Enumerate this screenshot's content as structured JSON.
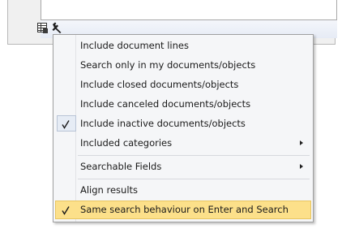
{
  "toolbar": {
    "icons": [
      "grid-icon",
      "wrench-icon"
    ]
  },
  "menu": {
    "items": [
      {
        "label": "Include document lines",
        "checked": false,
        "submenu": false
      },
      {
        "label": "Search only in my documents/objects",
        "checked": false,
        "submenu": false
      },
      {
        "label": "Include closed documents/objects",
        "checked": false,
        "submenu": false
      },
      {
        "label": "Include canceled documents/objects",
        "checked": false,
        "submenu": false
      },
      {
        "label": "Include inactive documents/objects",
        "checked": true,
        "submenu": false
      },
      {
        "label": "Included categories",
        "checked": false,
        "submenu": true
      },
      {
        "label": "Searchable Fields",
        "checked": false,
        "submenu": true
      },
      {
        "label": "Align results",
        "checked": false,
        "submenu": false
      },
      {
        "label": "Same search behaviour on Enter and Search",
        "checked": true,
        "submenu": false,
        "highlighted": true
      }
    ]
  },
  "colors": {
    "highlight": "#fce08a",
    "highlight_border": "#e8c560",
    "menu_background": "#f5f6f8"
  }
}
